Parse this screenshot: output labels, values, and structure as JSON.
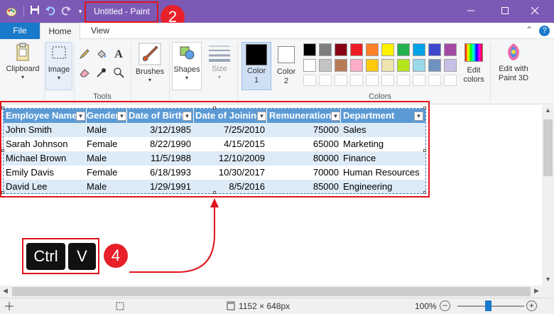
{
  "titlebar": {
    "title": "Untitled - Paint",
    "quick_access": [
      "paint-app-icon",
      "save-icon",
      "undo-icon",
      "redo-icon",
      "customize-quick-access-icon"
    ],
    "colors": {
      "background": "#7b5ab6"
    }
  },
  "tabs": {
    "file": "File",
    "home": "Home",
    "view": "View"
  },
  "ribbon": {
    "clipboard": "Clipboard",
    "image": "Image",
    "tools_group": "Tools",
    "brushes": "Brushes",
    "shapes": "Shapes",
    "size": "Size",
    "color1": "Color\n1",
    "color2": "Color\n2",
    "colors_group": "Colors",
    "edit_colors": "Edit\ncolors",
    "edit_paint3d": "Edit with\nPaint 3D",
    "palette_row1": [
      "#000000",
      "#7f7f7f",
      "#880015",
      "#ed1c24",
      "#ff7f27",
      "#fff200",
      "#22b14c",
      "#00a2e8",
      "#3f48cc",
      "#a349a4"
    ],
    "palette_row2": [
      "#ffffff",
      "#c3c3c3",
      "#b97a57",
      "#ffaec9",
      "#ffc90e",
      "#efe4b0",
      "#b5e61d",
      "#99d9ea",
      "#7092be",
      "#c8bfe7"
    ]
  },
  "table": {
    "headers": [
      "Employee Name",
      "Gender",
      "Date of Birth",
      "Date of Joining",
      "Remuneration",
      "Department"
    ],
    "rows": [
      [
        "John Smith",
        "Male",
        "3/12/1985",
        "7/25/2010",
        "75000",
        "Sales"
      ],
      [
        "Sarah Johnson",
        "Female",
        "8/22/1990",
        "4/15/2015",
        "65000",
        "Marketing"
      ],
      [
        "Michael Brown",
        "Male",
        "11/5/1988",
        "12/10/2009",
        "80000",
        "Finance"
      ],
      [
        "Emily Davis",
        "Female",
        "6/18/1993",
        "10/30/2017",
        "70000",
        "Human Resources"
      ],
      [
        "David Lee",
        "Male",
        "1/29/1991",
        "8/5/2016",
        "85000",
        "Engineering"
      ]
    ]
  },
  "annotations": {
    "step2": "2",
    "step4": "4",
    "key_ctrl": "Ctrl",
    "key_v": "V",
    "color": "#e0131b"
  },
  "statusbar": {
    "dimensions": "1152 × 648px",
    "zoom": "100%",
    "zoom_out": "−",
    "zoom_in": "+"
  }
}
